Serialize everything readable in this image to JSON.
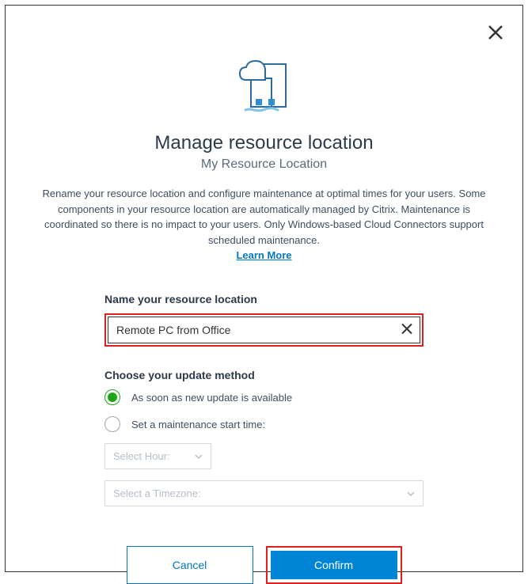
{
  "dialog": {
    "title": "Manage resource location",
    "subtitle": "My Resource Location",
    "description": "Rename your resource location and configure maintenance at optimal times for your users. Some components in your resource location are automatically managed by Citrix. Maintenance is coordinated so there is no impact to your users. Only Windows-based Cloud Connectors support scheduled maintenance.",
    "learn_more": "Learn More"
  },
  "form": {
    "name_label": "Name your resource location",
    "name_value": "Remote PC from Office",
    "update_label": "Choose your update method",
    "radio": {
      "option1": "As soon as new update is available",
      "option2": "Set a maintenance start time:",
      "selected": 0
    },
    "select_hour_placeholder": "Select Hour:",
    "select_timezone_placeholder": "Select a Timezone:"
  },
  "buttons": {
    "cancel": "Cancel",
    "confirm": "Confirm"
  }
}
